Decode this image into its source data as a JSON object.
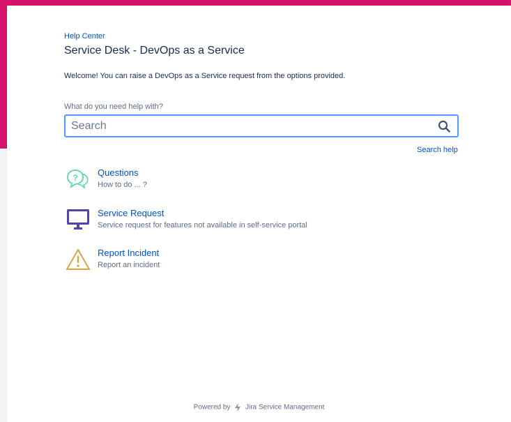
{
  "header": {
    "breadcrumb": "Help Center",
    "title": "Service Desk - DevOps as a Service",
    "welcome": "Welcome! You can raise a DevOps as a Service request from the options provided."
  },
  "search": {
    "label": "What do you need help with?",
    "placeholder": "Search",
    "value": "",
    "help_link": "Search help",
    "icon": "search-icon"
  },
  "options": [
    {
      "title": "Questions",
      "description": "How to do ... ?",
      "icon": "question-bubbles-icon",
      "color": "#57d9a3"
    },
    {
      "title": "Service Request",
      "description": "Service request for features not available in self-service portal",
      "icon": "monitor-icon",
      "color": "#5243aa"
    },
    {
      "title": "Report Incident",
      "description": "Report an incident",
      "icon": "warning-icon",
      "color": "#d9a441"
    }
  ],
  "footer": {
    "prefix": "Powered by",
    "product": "Jira Service Management",
    "icon": "jira-bolt-icon"
  },
  "colors": {
    "banner": "#d6136b",
    "link": "#0052cc",
    "focus": "#4c9aff"
  }
}
